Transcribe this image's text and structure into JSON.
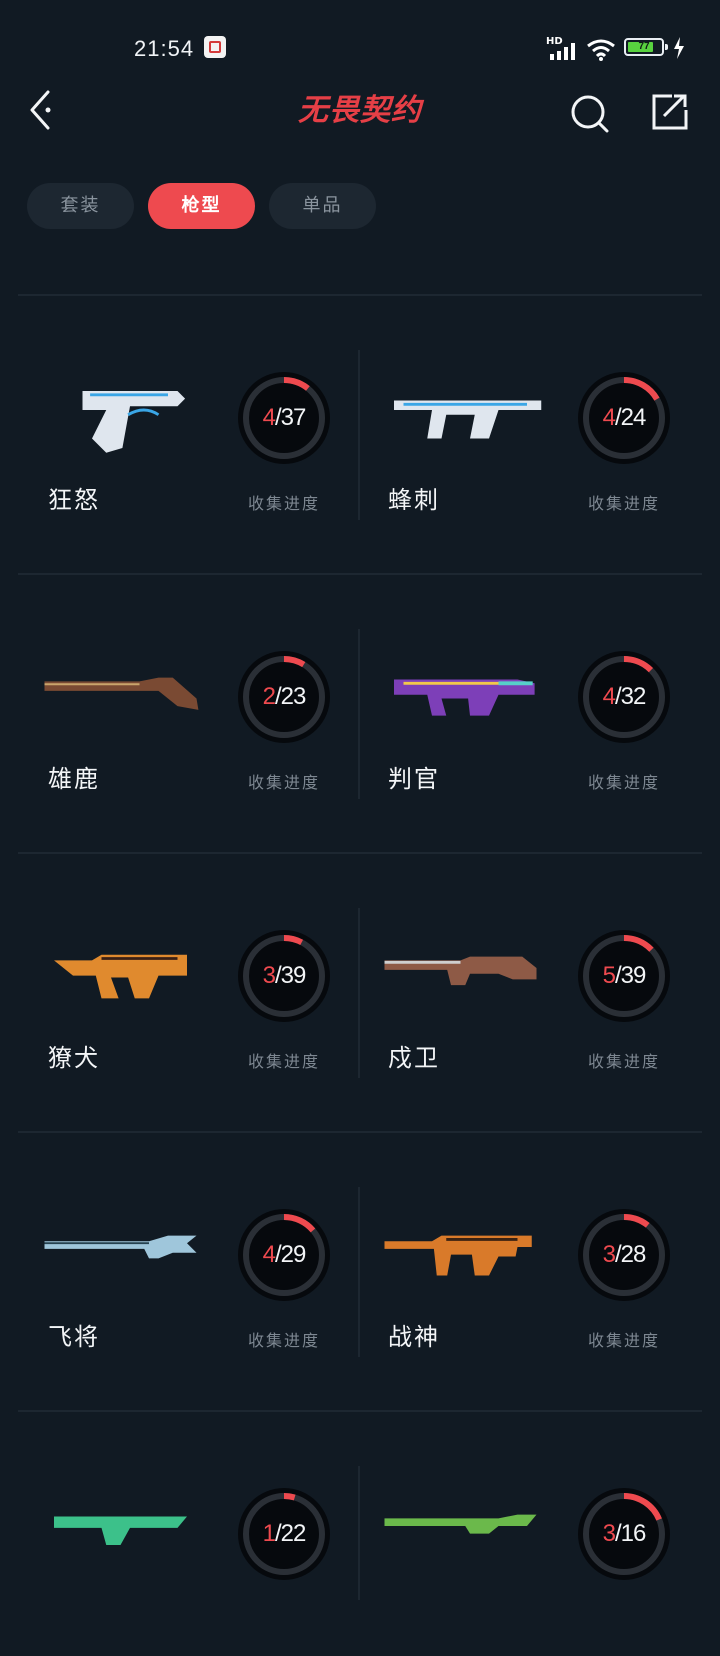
{
  "status_bar": {
    "time": "21:54",
    "network_label": "HD",
    "battery_percent": 77,
    "battery_text": "77"
  },
  "header": {
    "title": "无畏契约"
  },
  "tabs": [
    {
      "label": "套装",
      "active": false
    },
    {
      "label": "枪型",
      "active": true
    },
    {
      "label": "单品",
      "active": false
    }
  ],
  "weapons": [
    {
      "name": "狂怒",
      "collected": 4,
      "total": 37,
      "progress_label": "收集进度",
      "collected_text": "4",
      "total_text": "37"
    },
    {
      "name": "蜂刺",
      "collected": 4,
      "total": 24,
      "progress_label": "收集进度",
      "collected_text": "4",
      "total_text": "24"
    },
    {
      "name": "雄鹿",
      "collected": 2,
      "total": 23,
      "progress_label": "收集进度",
      "collected_text": "2",
      "total_text": "23"
    },
    {
      "name": "判官",
      "collected": 4,
      "total": 32,
      "progress_label": "收集进度",
      "collected_text": "4",
      "total_text": "32"
    },
    {
      "name": "獠犬",
      "collected": 3,
      "total": 39,
      "progress_label": "收集进度",
      "collected_text": "3",
      "total_text": "39"
    },
    {
      "name": "戍卫",
      "collected": 5,
      "total": 39,
      "progress_label": "收集进度",
      "collected_text": "5",
      "total_text": "39"
    },
    {
      "name": "飞将",
      "collected": 4,
      "total": 29,
      "progress_label": "收集进度",
      "collected_text": "4",
      "total_text": "29"
    },
    {
      "name": "战神",
      "collected": 3,
      "total": 28,
      "progress_label": "收集进度",
      "collected_text": "3",
      "total_text": "28"
    },
    {
      "name": "",
      "collected": 1,
      "total": 22,
      "progress_label": "",
      "collected_text": "1",
      "total_text": "22"
    },
    {
      "name": "",
      "collected": 3,
      "total": 16,
      "progress_label": "",
      "collected_text": "3",
      "total_text": "16"
    }
  ],
  "colors": {
    "accent": "#ee4a4f",
    "background": "#111a23",
    "ring_track": "#2a2f36"
  }
}
